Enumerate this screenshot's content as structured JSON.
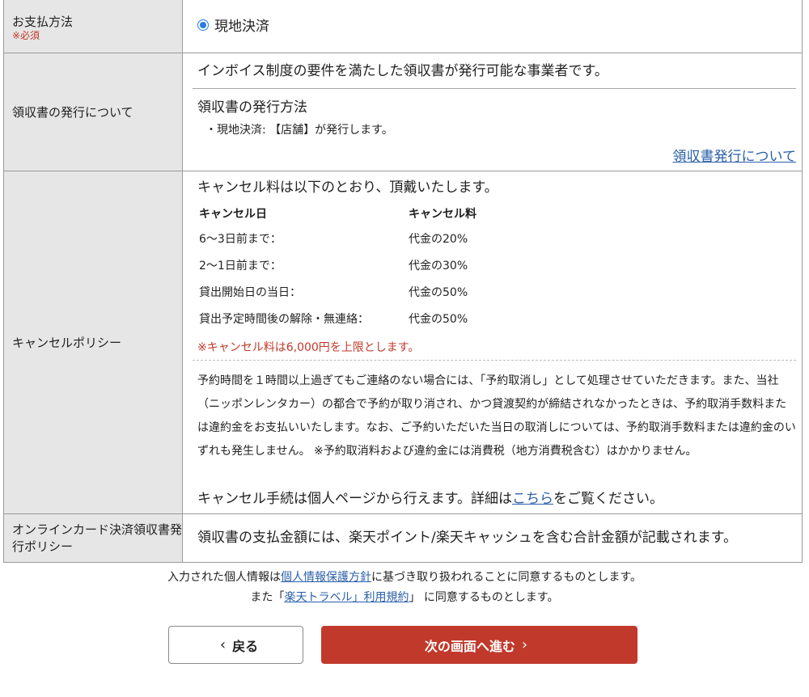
{
  "payment": {
    "label": "お支払方法",
    "required": "※必須",
    "option_label": "現地決済"
  },
  "receipt": {
    "label": "領収書の発行について",
    "statement": "インボイス制度の要件を満たした領収書が発行可能な事業者です。",
    "method_heading": "領収書の発行方法",
    "method_item": "・現地決済: 【店舗】が発行します。",
    "link": "領収書発行について"
  },
  "cancel_policy": {
    "label": "キャンセルポリシー",
    "intro": "キャンセル料は以下のとおり、頂戴いたします。",
    "headers": [
      "キャンセル日",
      "キャンセル料"
    ],
    "rows": [
      [
        "6〜3日前まで：",
        "代金の20%"
      ],
      [
        "2〜1日前まで：",
        "代金の30%"
      ],
      [
        "貸出開始日の当日：",
        "代金の50%"
      ],
      [
        "貸出予定時間後の解除・無連絡：",
        "代金の50%"
      ]
    ],
    "note": "※キャンセル料は6,000円を上限とします。",
    "paragraph": "予約時間を１時間以上過ぎてもご連絡のない場合には、「予約取消し」として処理させていただきます。また、当社（ニッポンレンタカー）の都合で予約が取り消され、かつ貸渡契約が締結されなかったときは、予約取消手数料または違約金をお支払いいたします。なお、ご予約いただいた当日の取消しについては、予約取消手数料または違約金のいずれも発生しません。 ※予約取消料および違約金には消費税（地方消費税含む）はかかりません。",
    "last_before": "キャンセル手続は個人ページから行えます。詳細は",
    "last_link": "こちら",
    "last_after": "をご覧ください。"
  },
  "online_policy": {
    "label": "オンラインカード決済領収書発行ポリシー",
    "text": "領収書の支払金額には、楽天ポイント/楽天キャッシュを含む合計金額が記載されます。"
  },
  "consent": {
    "line1_before": "入力された個人情報は",
    "line1_link": "個人情報保護方針",
    "line1_after": "に基づき取り扱われることに同意するものとします。",
    "line2_before": "また「",
    "line2_link": "楽天トラベル」利用規約",
    "line2_after": "」 に同意するものとします。"
  },
  "buttons": {
    "back": "戻る",
    "next": "次の画面へ進む"
  },
  "icons": {
    "back": "chevron-left-icon",
    "next": "chevron-right-icon"
  },
  "colors": {
    "accent_red": "#c0392b",
    "link_blue": "#2a5fa9",
    "radio_blue": "#2a7ae4",
    "header_gray": "#e6e6e6"
  }
}
